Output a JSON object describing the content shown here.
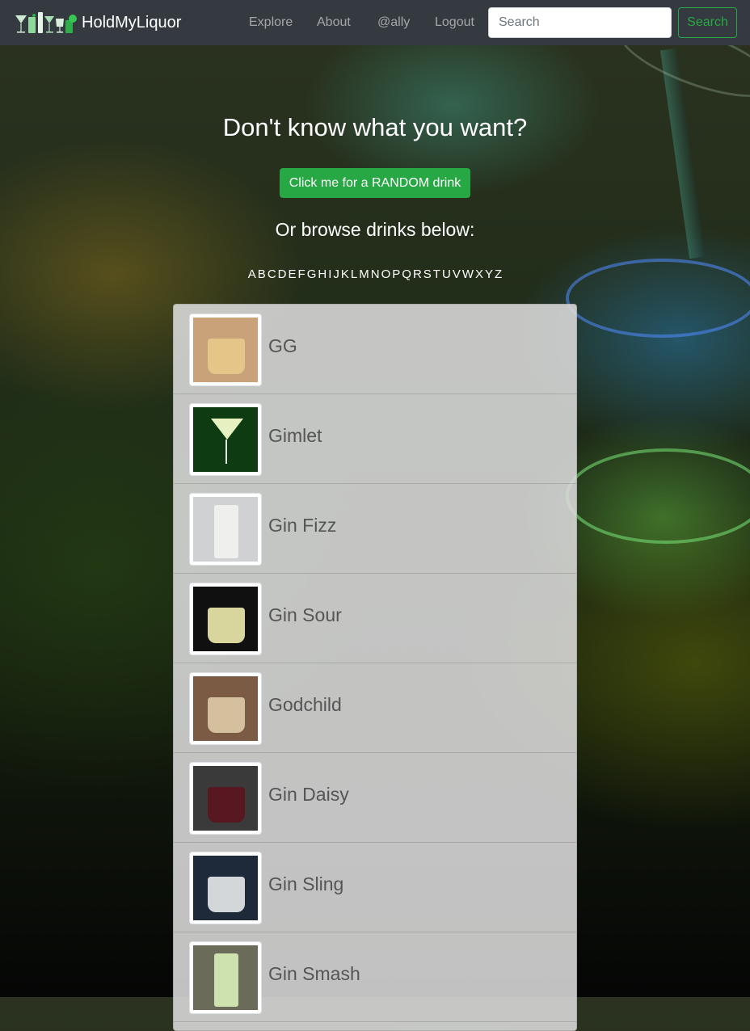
{
  "navbar": {
    "brand": "HoldMyLiquor",
    "links": [
      "Explore",
      "About",
      "@ally",
      "Logout"
    ],
    "search_placeholder": "Search",
    "search_button": "Search"
  },
  "hero": {
    "title": "Don't know what you want?",
    "random_button": "Click me for a RANDOM drink",
    "browse_title": "Or browse drinks below:"
  },
  "alphabet": [
    "A",
    "B",
    "C",
    "D",
    "E",
    "F",
    "G",
    "H",
    "I",
    "J",
    "K",
    "L",
    "M",
    "N",
    "O",
    "P",
    "Q",
    "R",
    "S",
    "T",
    "U",
    "V",
    "W",
    "X",
    "Y",
    "Z"
  ],
  "drinks": [
    {
      "name": "GG",
      "icon": "rocks-glass-icon",
      "bg": "#c9a27a",
      "liquid": "#e8c88a"
    },
    {
      "name": "Gimlet",
      "icon": "martini-glass-icon",
      "bg": "#0e3b12",
      "liquid": "#e6f0c0"
    },
    {
      "name": "Gin Fizz",
      "icon": "highball-glass-icon",
      "bg": "#cfd1d2",
      "liquid": "#f2f2f0"
    },
    {
      "name": "Gin Sour",
      "icon": "sour-glass-icon",
      "bg": "#101010",
      "liquid": "#e9e7a8"
    },
    {
      "name": "Godchild",
      "icon": "cream-glass-icon",
      "bg": "#7c5b45",
      "liquid": "#dcc9a6"
    },
    {
      "name": "Gin Daisy",
      "icon": "daisy-glass-icon",
      "bg": "#3a3a3a",
      "liquid": "#5a1620"
    },
    {
      "name": "Gin Sling",
      "icon": "sling-glass-icon",
      "bg": "#1e2a3a",
      "liquid": "#e4e6e8"
    },
    {
      "name": "Gin Smash",
      "icon": "smash-glass-icon",
      "bg": "#6b6b5a",
      "liquid": "#d8f0b8"
    }
  ]
}
